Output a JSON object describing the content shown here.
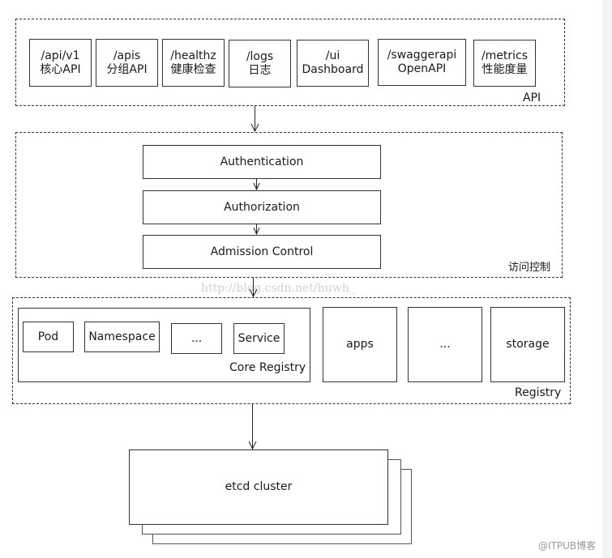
{
  "api_layer": {
    "label": "API",
    "endpoints": [
      {
        "path": "/api/v1",
        "desc": "核心API"
      },
      {
        "path": "/apis",
        "desc": "分组API"
      },
      {
        "path": "/healthz",
        "desc": "健康检查"
      },
      {
        "path": "/logs",
        "desc": "日志"
      },
      {
        "path": "/ui",
        "desc": "Dashboard"
      },
      {
        "path": "/swaggerapi",
        "desc": "OpenAPI"
      },
      {
        "path": "/metrics",
        "desc": "性能度量"
      }
    ]
  },
  "access_control": {
    "label": "访问控制",
    "steps": [
      "Authentication",
      "Authorization",
      "Admission Control"
    ]
  },
  "registry": {
    "label": "Registry",
    "core": {
      "label": "Core Registry",
      "items": [
        "Pod",
        "Namespace",
        "...",
        "Service"
      ]
    },
    "groups": [
      "apps",
      "...",
      "storage"
    ]
  },
  "storage": {
    "label": "etcd cluster"
  },
  "watermark": "http://blog.csdn.net/huwh_",
  "footer": "@ITPUB博客"
}
